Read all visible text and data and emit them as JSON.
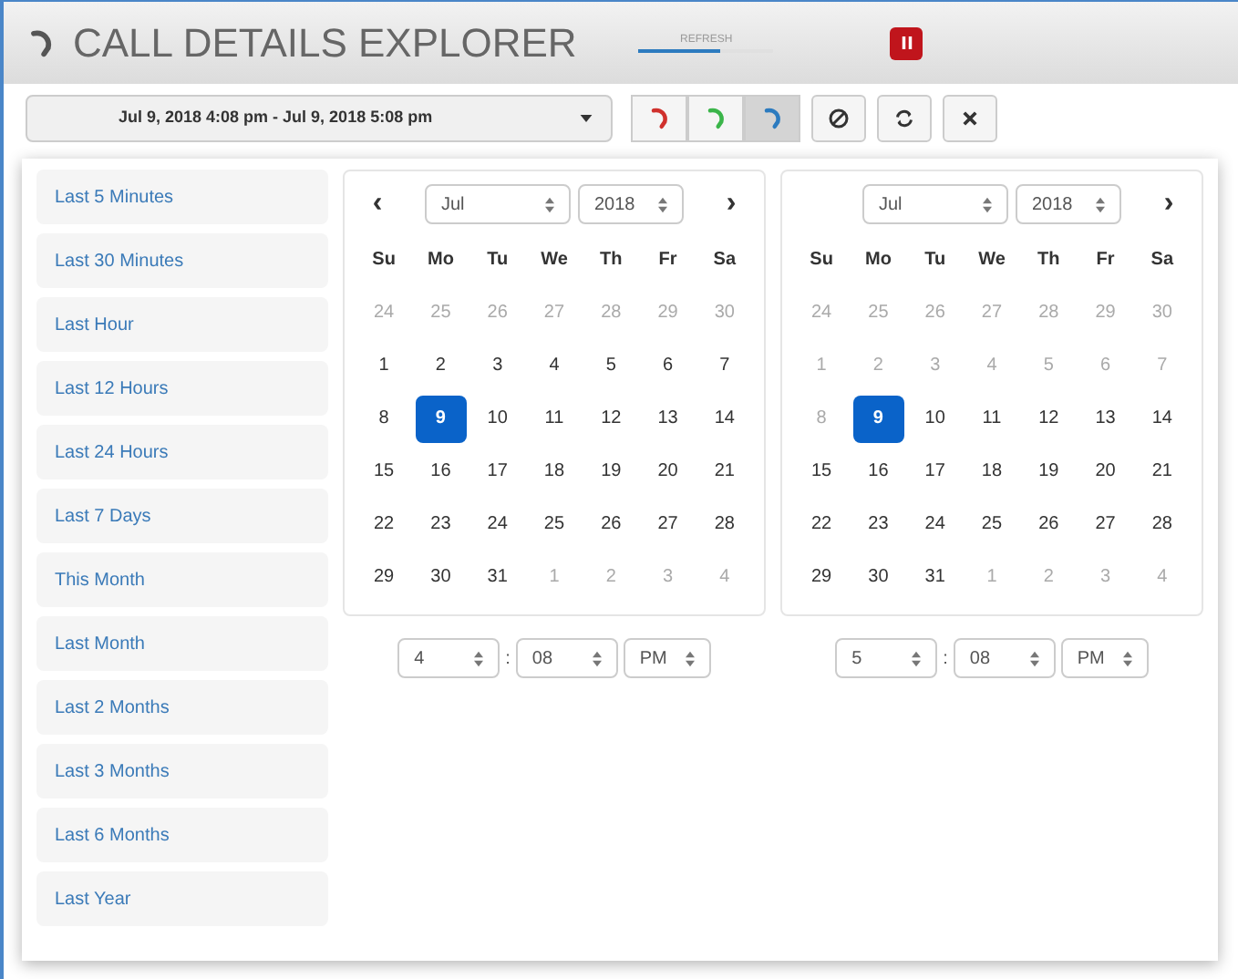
{
  "window": {
    "title": "CALL DETAILS EXPLORER"
  },
  "refresh": {
    "label": "REFRESH",
    "level": 0.6
  },
  "pause_button": {
    "kind": "pause"
  },
  "range_field": {
    "value": "Jul 9, 2018 4:08 pm - Jul 9, 2018 5:08 pm"
  },
  "toolbar": [
    {
      "kind": "call-red",
      "selected": false
    },
    {
      "kind": "call-green",
      "selected": false
    },
    {
      "kind": "call-blue",
      "selected": true
    },
    {
      "kind": "block",
      "selected": false
    },
    {
      "kind": "refresh",
      "selected": false
    },
    {
      "kind": "close",
      "selected": false
    }
  ],
  "ranges": [
    "Last 5 Minutes",
    "Last 30 Minutes",
    "Last Hour",
    "Last 12 Hours",
    "Last 24 Hours",
    "Last 7 Days",
    "This Month",
    "Last Month",
    "Last 2 Months",
    "Last 3 Months",
    "Last 6 Months",
    "Last Year"
  ],
  "calendars": [
    {
      "prev": "‹",
      "next": "›",
      "month": "Jul",
      "year": "2018",
      "weekdays": [
        "Su",
        "Mo",
        "Tu",
        "We",
        "Th",
        "Fr",
        "Sa"
      ],
      "weeks": [
        [
          {
            "d": "24",
            "muted": true,
            "selected": false
          },
          {
            "d": "25",
            "muted": true,
            "selected": false
          },
          {
            "d": "26",
            "muted": true,
            "selected": false
          },
          {
            "d": "27",
            "muted": true,
            "selected": false
          },
          {
            "d": "28",
            "muted": true,
            "selected": false
          },
          {
            "d": "29",
            "muted": true,
            "selected": false
          },
          {
            "d": "30",
            "muted": true,
            "selected": false
          }
        ],
        [
          {
            "d": "1",
            "muted": false,
            "selected": false
          },
          {
            "d": "2",
            "muted": false,
            "selected": false
          },
          {
            "d": "3",
            "muted": false,
            "selected": false
          },
          {
            "d": "4",
            "muted": false,
            "selected": false
          },
          {
            "d": "5",
            "muted": false,
            "selected": false
          },
          {
            "d": "6",
            "muted": false,
            "selected": false
          },
          {
            "d": "7",
            "muted": false,
            "selected": false
          }
        ],
        [
          {
            "d": "8",
            "muted": false,
            "selected": false
          },
          {
            "d": "9",
            "muted": false,
            "selected": true
          },
          {
            "d": "10",
            "muted": false,
            "selected": false
          },
          {
            "d": "11",
            "muted": false,
            "selected": false
          },
          {
            "d": "12",
            "muted": false,
            "selected": false
          },
          {
            "d": "13",
            "muted": false,
            "selected": false
          },
          {
            "d": "14",
            "muted": false,
            "selected": false
          }
        ],
        [
          {
            "d": "15",
            "muted": false,
            "selected": false
          },
          {
            "d": "16",
            "muted": false,
            "selected": false
          },
          {
            "d": "17",
            "muted": false,
            "selected": false
          },
          {
            "d": "18",
            "muted": false,
            "selected": false
          },
          {
            "d": "19",
            "muted": false,
            "selected": false
          },
          {
            "d": "20",
            "muted": false,
            "selected": false
          },
          {
            "d": "21",
            "muted": false,
            "selected": false
          }
        ],
        [
          {
            "d": "22",
            "muted": false,
            "selected": false
          },
          {
            "d": "23",
            "muted": false,
            "selected": false
          },
          {
            "d": "24",
            "muted": false,
            "selected": false
          },
          {
            "d": "25",
            "muted": false,
            "selected": false
          },
          {
            "d": "26",
            "muted": false,
            "selected": false
          },
          {
            "d": "27",
            "muted": false,
            "selected": false
          },
          {
            "d": "28",
            "muted": false,
            "selected": false
          }
        ],
        [
          {
            "d": "29",
            "muted": false,
            "selected": false
          },
          {
            "d": "30",
            "muted": false,
            "selected": false
          },
          {
            "d": "31",
            "muted": false,
            "selected": false
          },
          {
            "d": "1",
            "muted": true,
            "selected": false
          },
          {
            "d": "2",
            "muted": true,
            "selected": false
          },
          {
            "d": "3",
            "muted": true,
            "selected": false
          },
          {
            "d": "4",
            "muted": true,
            "selected": false
          }
        ]
      ],
      "time": {
        "hour": "4",
        "separator": ":",
        "minute": "08",
        "ampm": "PM"
      }
    },
    {
      "next": "›",
      "month": "Jul",
      "year": "2018",
      "weekdays": [
        "Su",
        "Mo",
        "Tu",
        "We",
        "Th",
        "Fr",
        "Sa"
      ],
      "weeks": [
        [
          {
            "d": "24",
            "muted": true,
            "selected": false
          },
          {
            "d": "25",
            "muted": true,
            "selected": false
          },
          {
            "d": "26",
            "muted": true,
            "selected": false
          },
          {
            "d": "27",
            "muted": true,
            "selected": false
          },
          {
            "d": "28",
            "muted": true,
            "selected": false
          },
          {
            "d": "29",
            "muted": true,
            "selected": false
          },
          {
            "d": "30",
            "muted": true,
            "selected": false
          }
        ],
        [
          {
            "d": "1",
            "muted": true,
            "selected": false
          },
          {
            "d": "2",
            "muted": true,
            "selected": false
          },
          {
            "d": "3",
            "muted": true,
            "selected": false
          },
          {
            "d": "4",
            "muted": true,
            "selected": false
          },
          {
            "d": "5",
            "muted": true,
            "selected": false
          },
          {
            "d": "6",
            "muted": true,
            "selected": false
          },
          {
            "d": "7",
            "muted": true,
            "selected": false
          }
        ],
        [
          {
            "d": "8",
            "muted": true,
            "selected": false
          },
          {
            "d": "9",
            "muted": false,
            "selected": true
          },
          {
            "d": "10",
            "muted": false,
            "selected": false
          },
          {
            "d": "11",
            "muted": false,
            "selected": false
          },
          {
            "d": "12",
            "muted": false,
            "selected": false
          },
          {
            "d": "13",
            "muted": false,
            "selected": false
          },
          {
            "d": "14",
            "muted": false,
            "selected": false
          }
        ],
        [
          {
            "d": "15",
            "muted": false,
            "selected": false
          },
          {
            "d": "16",
            "muted": false,
            "selected": false
          },
          {
            "d": "17",
            "muted": false,
            "selected": false
          },
          {
            "d": "18",
            "muted": false,
            "selected": false
          },
          {
            "d": "19",
            "muted": false,
            "selected": false
          },
          {
            "d": "20",
            "muted": false,
            "selected": false
          },
          {
            "d": "21",
            "muted": false,
            "selected": false
          }
        ],
        [
          {
            "d": "22",
            "muted": false,
            "selected": false
          },
          {
            "d": "23",
            "muted": false,
            "selected": false
          },
          {
            "d": "24",
            "muted": false,
            "selected": false
          },
          {
            "d": "25",
            "muted": false,
            "selected": false
          },
          {
            "d": "26",
            "muted": false,
            "selected": false
          },
          {
            "d": "27",
            "muted": false,
            "selected": false
          },
          {
            "d": "28",
            "muted": false,
            "selected": false
          }
        ],
        [
          {
            "d": "29",
            "muted": false,
            "selected": false
          },
          {
            "d": "30",
            "muted": false,
            "selected": false
          },
          {
            "d": "31",
            "muted": false,
            "selected": false
          },
          {
            "d": "1",
            "muted": true,
            "selected": false
          },
          {
            "d": "2",
            "muted": true,
            "selected": false
          },
          {
            "d": "3",
            "muted": true,
            "selected": false
          },
          {
            "d": "4",
            "muted": true,
            "selected": false
          }
        ]
      ],
      "time": {
        "hour": "5",
        "separator": ":",
        "minute": "08",
        "ampm": "PM"
      }
    }
  ]
}
